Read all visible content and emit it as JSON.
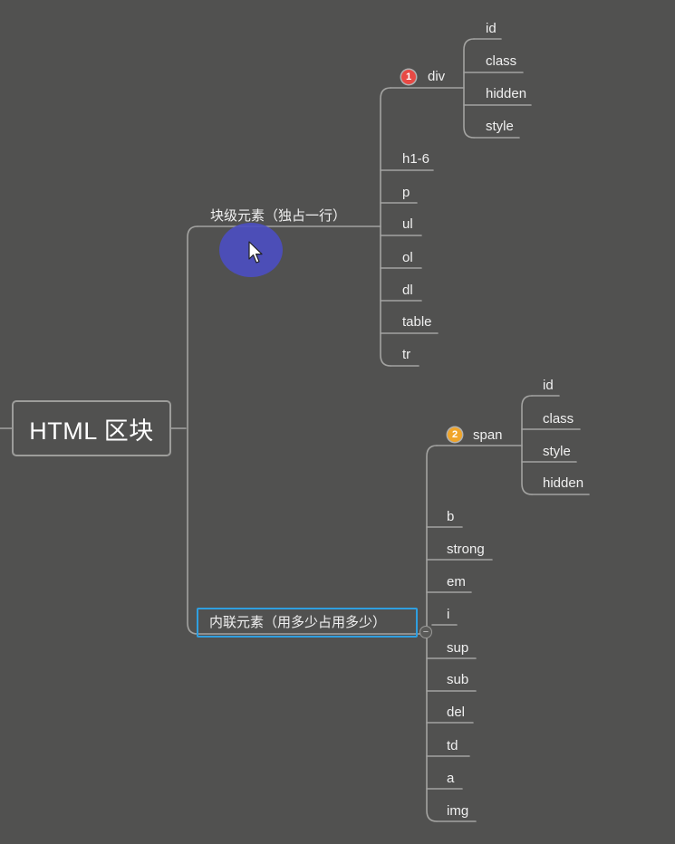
{
  "root": {
    "label": "HTML 区块"
  },
  "block": {
    "label": "块级元素（独占一行）",
    "div": {
      "badge": "1",
      "label": "div",
      "children": [
        "id",
        "class",
        "hidden",
        "style"
      ]
    },
    "items": [
      "h1-6",
      "p",
      "ul",
      "ol",
      "dl",
      "table",
      "tr"
    ]
  },
  "inline": {
    "label": "内联元素（用多少占用多少）",
    "span": {
      "badge": "2",
      "label": "span",
      "children": [
        "id",
        "class",
        "style",
        "hidden"
      ]
    },
    "items": [
      "b",
      "strong",
      "em",
      "i",
      "sup",
      "sub",
      "del",
      "td",
      "a",
      "img"
    ],
    "collapse_symbol": "−"
  },
  "colors": {
    "background": "#515150",
    "line": "#a3a3a1",
    "selection": "#2f9fe0",
    "badge1": "#e84a45",
    "badge2": "#f0a52a",
    "cursor_halo": "#4c4ec0"
  }
}
